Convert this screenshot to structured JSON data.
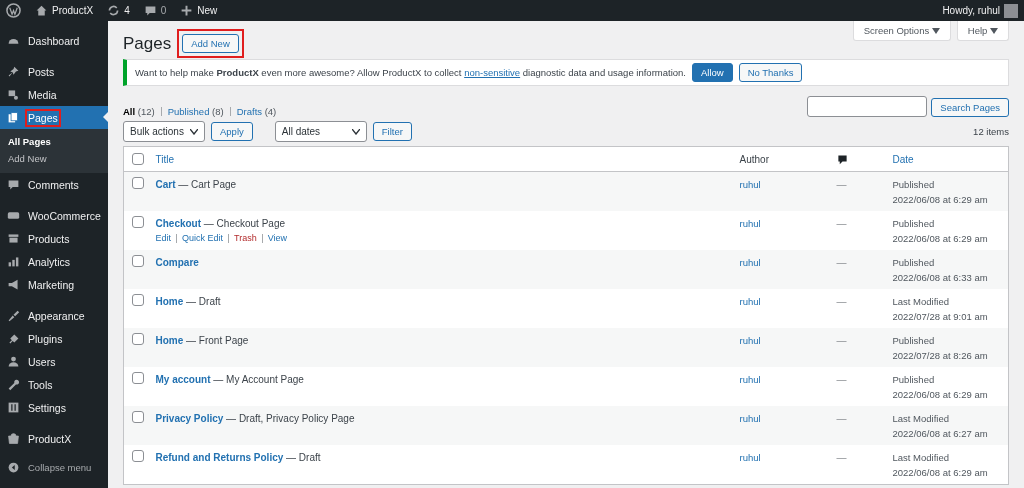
{
  "admin_bar": {
    "site": "ProductX",
    "updates": "4",
    "comments": "0",
    "new": "New",
    "greeting": "Howdy, ruhul"
  },
  "sidebar": {
    "groups": [
      [
        {
          "label": "Dashboard",
          "selected": false
        }
      ],
      [
        {
          "label": "Posts",
          "selected": false
        },
        {
          "label": "Media",
          "selected": false
        },
        {
          "label": "Pages",
          "selected": true,
          "highlighted": true,
          "children": [
            {
              "label": "All Pages",
              "selected": true
            },
            {
              "label": "Add New",
              "selected": false
            }
          ]
        },
        {
          "label": "Comments",
          "selected": false
        }
      ],
      [
        {
          "label": "WooCommerce",
          "selected": false
        },
        {
          "label": "Products",
          "selected": false
        },
        {
          "label": "Analytics",
          "selected": false
        },
        {
          "label": "Marketing",
          "selected": false
        }
      ],
      [
        {
          "label": "Appearance",
          "selected": false
        },
        {
          "label": "Plugins",
          "selected": false
        },
        {
          "label": "Users",
          "selected": false
        },
        {
          "label": "Tools",
          "selected": false
        },
        {
          "label": "Settings",
          "selected": false
        }
      ],
      [
        {
          "label": "ProductX",
          "selected": false
        }
      ]
    ],
    "collapse": "Collapse menu"
  },
  "screen_tabs": [
    "Screen Options",
    "Help"
  ],
  "page_title": "Pages",
  "add_new": {
    "label": "Add New",
    "highlighted": true
  },
  "notice": {
    "text": "Want to help make **ProductX** even more awesome? Allow ProductX to collect",
    "link": "non-sensitive",
    "text_after": "diagnostic data and usage information.",
    "allow": "Allow",
    "decline": "No Thanks"
  },
  "views": [
    {
      "label": "All",
      "count": "(12)",
      "selected": true
    },
    {
      "label": "Published",
      "count": "(8)",
      "selected": false
    },
    {
      "label": "Drafts",
      "count": "(4)",
      "selected": false
    }
  ],
  "search": {
    "button": "Search Pages"
  },
  "bulk_actions": {
    "value": "Bulk actions",
    "apply": "Apply"
  },
  "date_filter": {
    "value": "All dates",
    "filter": "Filter"
  },
  "items_count": "12 items",
  "table": {
    "select_all_checked": false,
    "columns": [
      "Title",
      "Author",
      "Date"
    ],
    "rows": [
      {
        "title": "Cart",
        "state": "— Cart Page",
        "author": "ruhul",
        "comments": "—",
        "status": "Published",
        "date": "2022/06/08 at 6:29 am",
        "checked": false
      },
      {
        "title": "Checkout",
        "state": "— Checkout Page",
        "author": "ruhul",
        "comments": "—",
        "status": "Published",
        "date": "2022/06/08 at 6:29 am",
        "checked": false,
        "row_actions": [
          {
            "label": "Edit",
            "kind": "normal"
          },
          {
            "label": "Quick Edit",
            "kind": "normal"
          },
          {
            "label": "Trash",
            "kind": "delete"
          },
          {
            "label": "View",
            "kind": "normal"
          }
        ]
      },
      {
        "title": "Compare",
        "author": "ruhul",
        "comments": "—",
        "status": "Published",
        "date": "2022/06/08 at 6:33 am",
        "checked": false
      },
      {
        "title": "Home",
        "state": "— Draft",
        "author": "ruhul",
        "comments": "—",
        "status": "Last Modified",
        "date": "2022/07/28 at 9:01 am",
        "checked": false
      },
      {
        "title": "Home",
        "state": "— Front Page",
        "author": "ruhul",
        "comments": "—",
        "status": "Published",
        "date": "2022/07/28 at 8:26 am",
        "checked": false
      },
      {
        "title": "My account",
        "state": "— My Account Page",
        "author": "ruhul",
        "comments": "—",
        "status": "Published",
        "date": "2022/06/08 at 6:29 am",
        "checked": false
      },
      {
        "title": "Privacy Policy",
        "state": "— Draft, Privacy Policy Page",
        "author": "ruhul",
        "comments": "—",
        "status": "Last Modified",
        "date": "2022/06/08 at 6:27 am",
        "checked": false
      },
      {
        "title": "Refund and Returns Policy",
        "state": "— Draft",
        "author": "ruhul",
        "comments": "—",
        "status": "Last Modified",
        "date": "2022/06/08 at 6:29 am",
        "checked": false
      }
    ]
  }
}
